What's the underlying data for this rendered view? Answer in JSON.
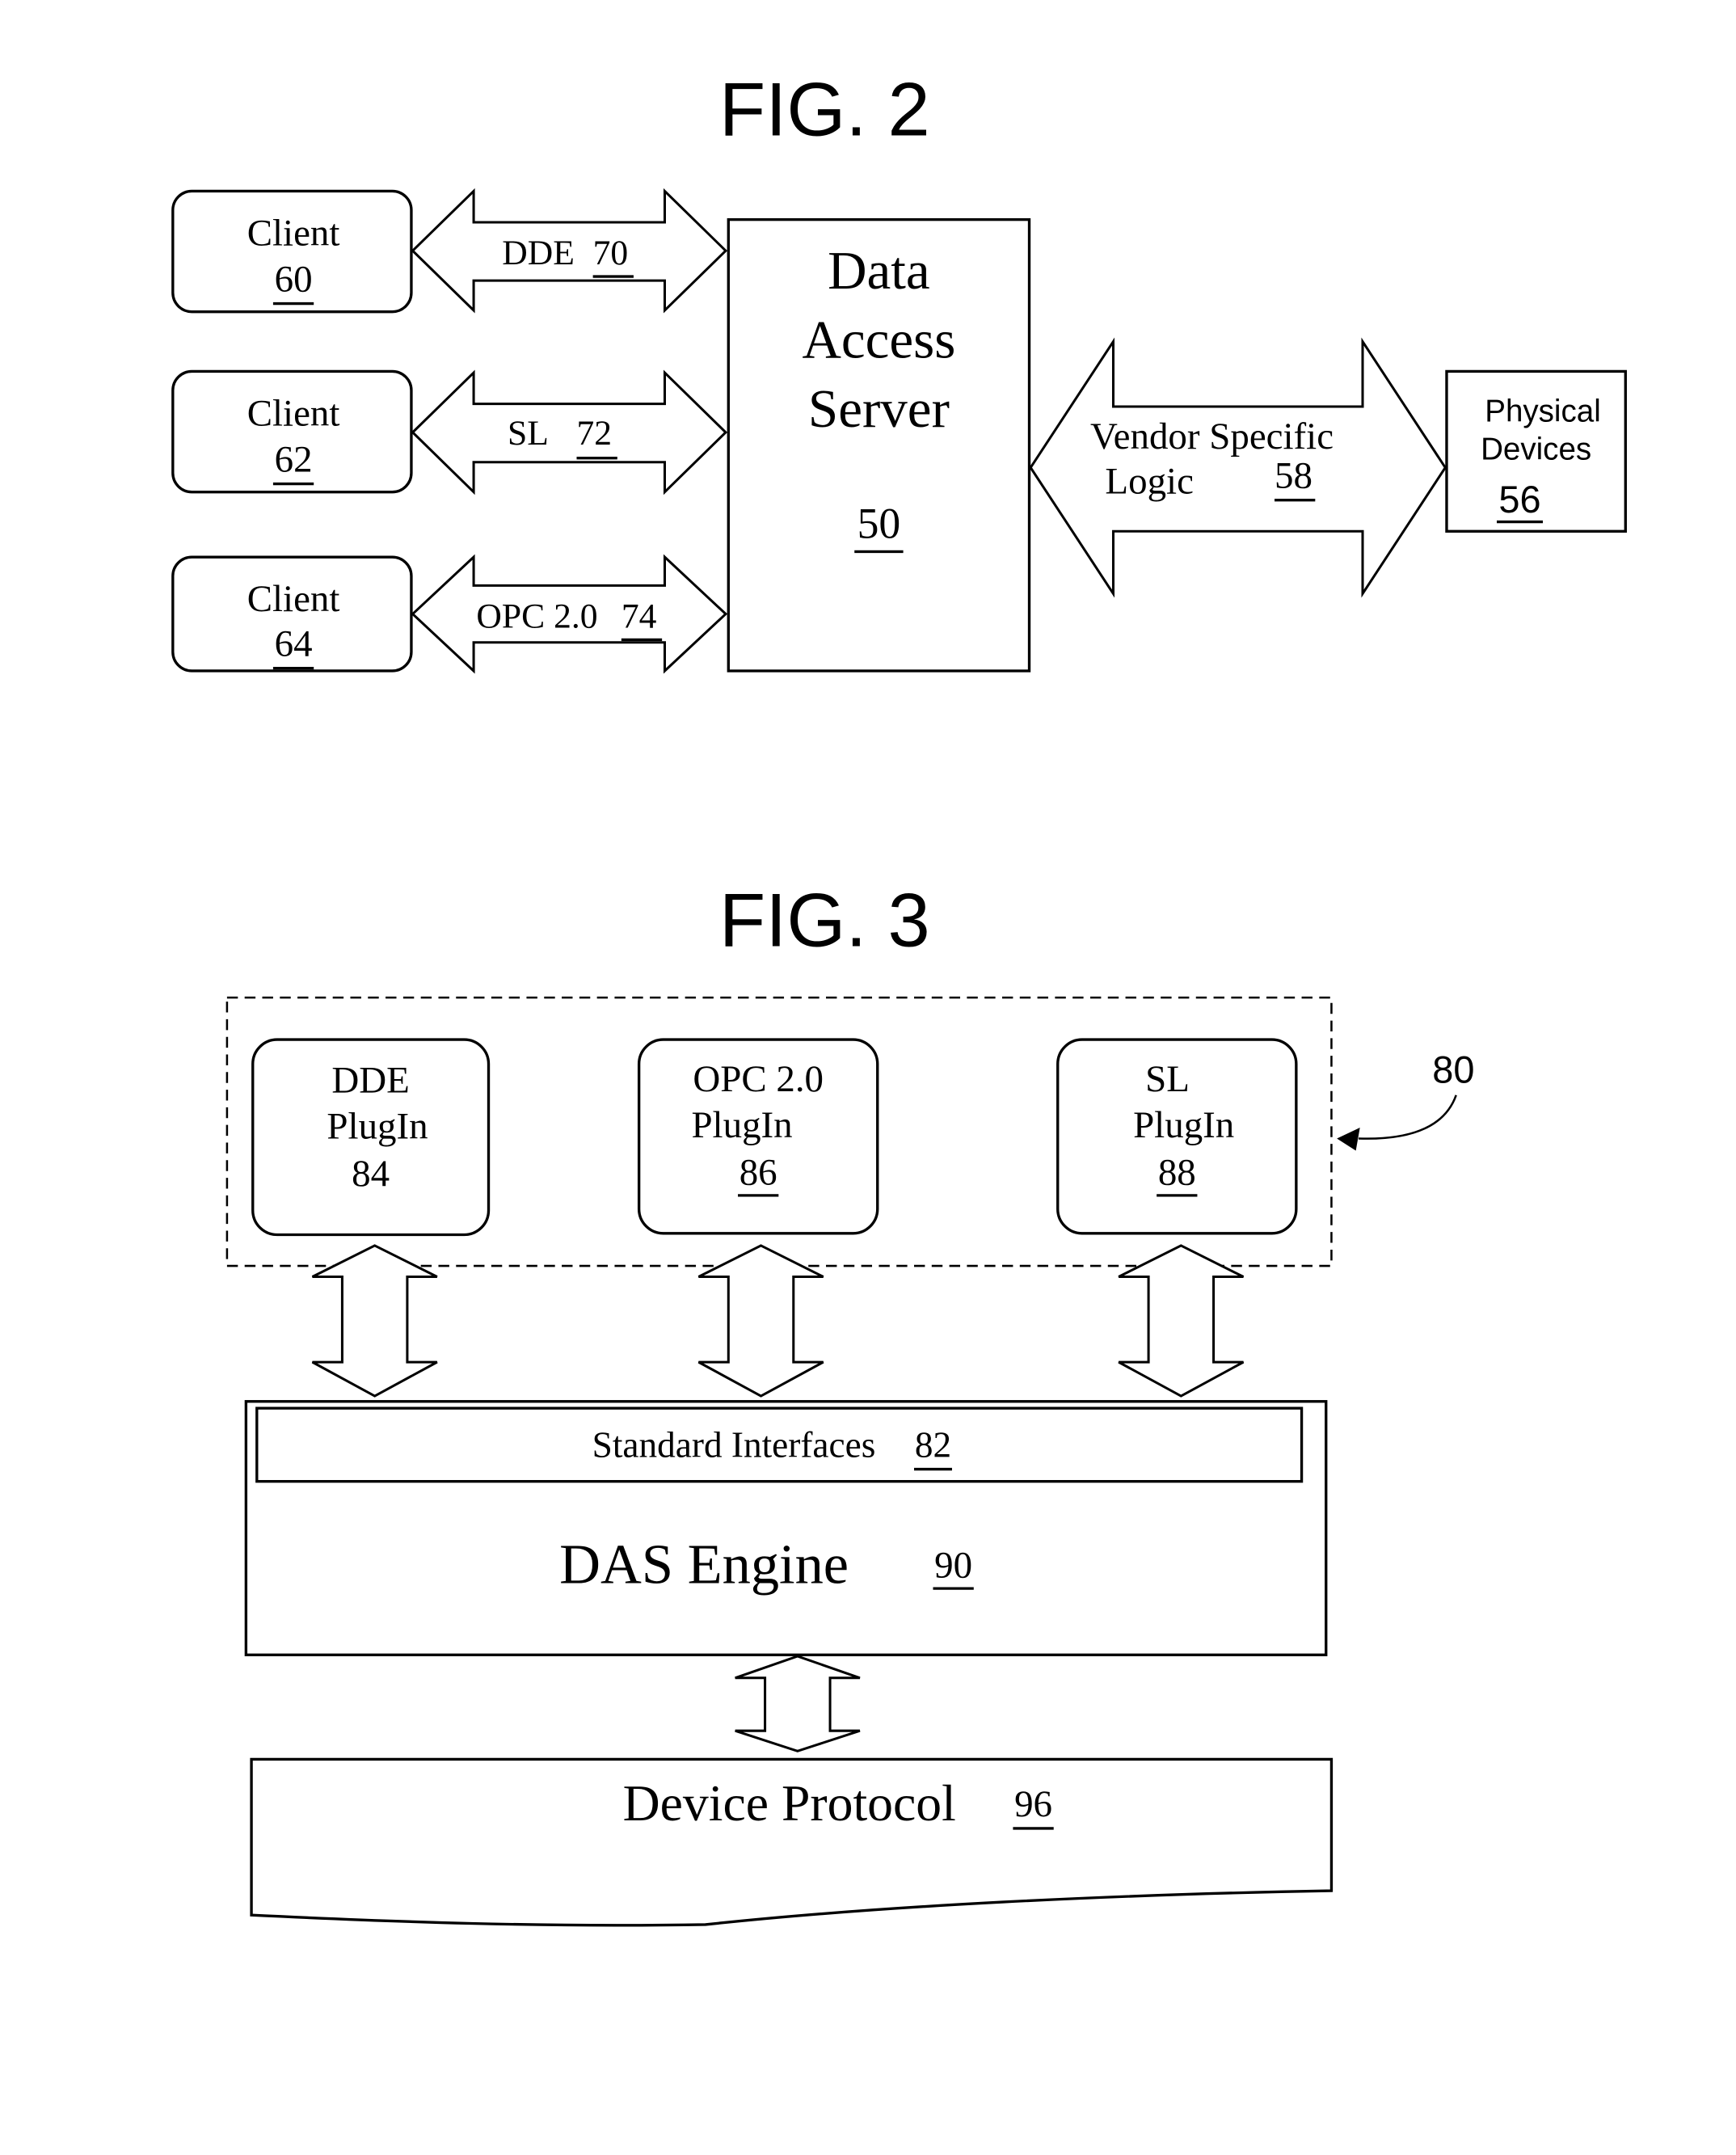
{
  "fig2": {
    "title": "FIG. 2",
    "clients": [
      {
        "label": "Client",
        "ref": "60"
      },
      {
        "label": "Client",
        "ref": "62"
      },
      {
        "label": "Client",
        "ref": "64"
      }
    ],
    "links": [
      {
        "label": "DDE",
        "ref": "70"
      },
      {
        "label": "SL",
        "ref": "72"
      },
      {
        "label": "OPC 2.0",
        "ref": "74"
      }
    ],
    "server": {
      "line1": "Data",
      "line2": "Access",
      "line3": "Server",
      "ref": "50"
    },
    "vendor_logic": {
      "line1": "Vendor Specific",
      "line2": "Logic",
      "ref": "58"
    },
    "physical_devices": {
      "line1": "Physical",
      "line2": "Devices",
      "ref": "56"
    }
  },
  "fig3": {
    "title": "FIG. 3",
    "group_ref": "80",
    "plugins": [
      {
        "line1": "DDE",
        "line2": "PlugIn",
        "ref": "84"
      },
      {
        "line1": "OPC 2.0",
        "line2": "PlugIn",
        "ref": "86"
      },
      {
        "line1": "SL",
        "line2": "PlugIn",
        "ref": "88"
      }
    ],
    "standard_interfaces": {
      "label": "Standard Interfaces",
      "ref": "82"
    },
    "das_engine": {
      "label": "DAS Engine",
      "ref": "90"
    },
    "device_protocol": {
      "label": "Device Protocol",
      "ref": "96"
    }
  }
}
